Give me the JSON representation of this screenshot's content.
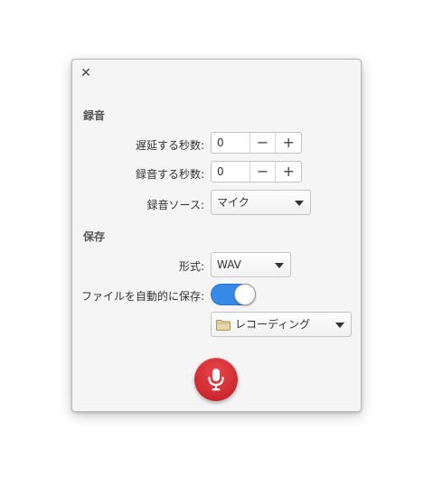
{
  "window": {
    "close_icon": "close-icon"
  },
  "recording": {
    "header": "録音",
    "delay_label": "遅延する秒数:",
    "delay_value": "0",
    "duration_label": "録音する秒数:",
    "duration_value": "0",
    "source_label": "録音ソース:",
    "source_value": "マイク",
    "minus_glyph": "−",
    "plus_glyph": "+"
  },
  "saving": {
    "header": "保存",
    "format_label": "形式:",
    "format_value": "WAV",
    "autosave_label": "ファイルを自動的に保存:",
    "autosave_enabled": true,
    "folder_value": "レコーディング",
    "folder_icon": "folder-icon"
  },
  "record_button": {
    "icon": "microphone-icon"
  },
  "colors": {
    "toggle_on": "#3689e6",
    "record_red": "#cc2a30"
  }
}
